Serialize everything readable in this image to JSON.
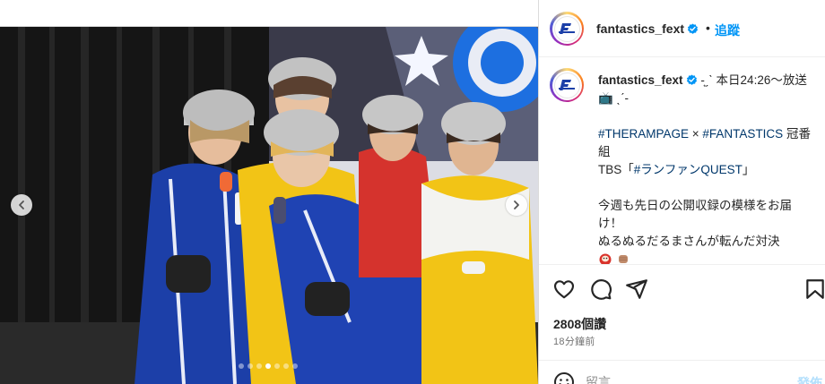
{
  "post": {
    "username": "fantastics_fext",
    "separator": "•",
    "follow_label": "追蹤",
    "avatar_logo_text": "FANTASTICS",
    "caption": {
      "line1_prefix": "-͙ˏˋ 本日24:26～放送",
      "line2": "📺 ˎˊ-",
      "hashtag1": "#THERAMPAGE",
      "cross": " × ",
      "hashtag2": "#FANTASTICS",
      "line3_suffix": " 冠番組",
      "line4_prefix": "TBS「",
      "hashtag3": "#ランファンQUEST",
      "line4_suffix": "」",
      "line5": "今週も先日の公開収録の模様をお届け！",
      "line6": "ぬるぬるだるまさんが転んだ対決"
    },
    "likes": "2808個讚",
    "time": "18分鐘前",
    "comment_placeholder": "留言......",
    "post_button": "發佈",
    "carousel": {
      "total": 7,
      "active": 3
    }
  },
  "colors": {
    "accent": "#0095f6",
    "link": "#00376b",
    "tracksuit_blue": "#1c3fa8",
    "tracksuit_yellow": "#f2c416"
  },
  "icons": {
    "like": "heart-icon",
    "comment": "comment-icon",
    "share": "send-icon",
    "save": "bookmark-icon",
    "more": "more-icon",
    "emoji": "smiley-icon",
    "verified": "verified-badge-icon"
  }
}
